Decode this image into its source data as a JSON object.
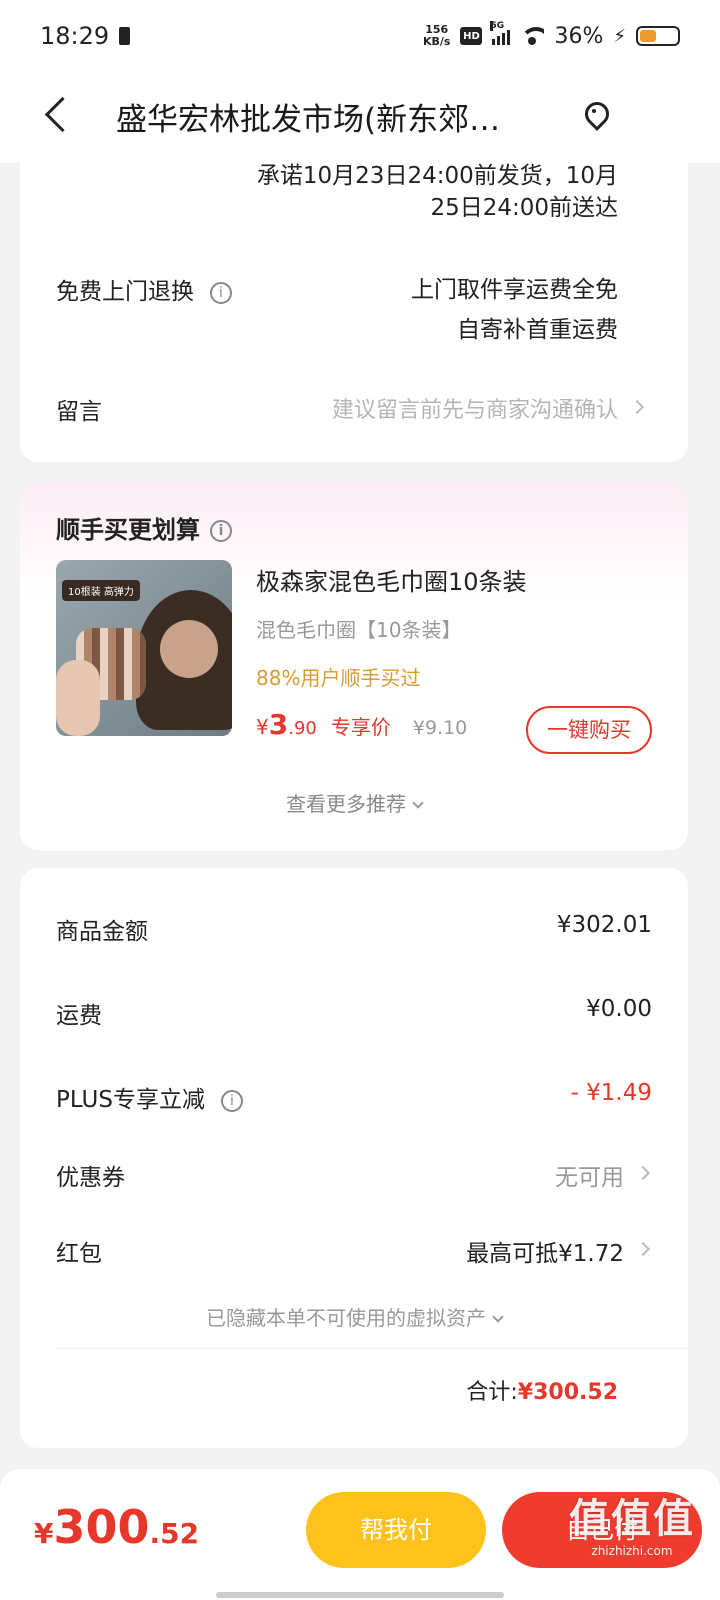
{
  "status_bar": {
    "time": "18:29",
    "net_speed_value": "156",
    "net_speed_unit": "KB/s",
    "hd": "HD",
    "network": "5G",
    "battery": "36%"
  },
  "nav": {
    "title": "盛华宏林批发市场(新东郊…"
  },
  "shipping": {
    "promise_line1": "承诺10月23日24:00前发货，10月",
    "promise_line2": "25日24:00前送达",
    "return_label": "免费上门退换",
    "return_line1": "上门取件享运费全免",
    "return_line2": "自寄补首重运费",
    "message_label": "留言",
    "message_placeholder": "建议留言前先与商家沟通确认"
  },
  "recommend": {
    "title": "顺手买更划算",
    "image_tag": "10根装 高弹力",
    "product_name": "极森家混色毛巾圈10条装",
    "sku": "混色毛巾圈【10条装】",
    "stat": "88%用户顺手买过",
    "price_symbol": "¥",
    "price_int": "3",
    "price_dec": ".90",
    "price_tag": "专享价",
    "original_price": "¥9.10",
    "buy_button": "一键购买",
    "more": "查看更多推荐"
  },
  "summary": {
    "goods_label": "商品金额",
    "goods_value": "¥302.01",
    "shipping_label": "运费",
    "shipping_value": "¥0.00",
    "plus_label": "PLUS专享立减",
    "plus_value": "- ¥1.49",
    "coupon_label": "优惠券",
    "coupon_value": "无可用",
    "redpacket_label": "红包",
    "redpacket_value": "最高可抵¥1.72",
    "hidden_assets": "已隐藏本单不可使用的虚拟资产",
    "total_label": "合计:",
    "total_value": "¥300.52"
  },
  "bottom": {
    "price_symbol": "¥",
    "price_int": "300",
    "price_dec": ".52",
    "help_pay": "帮我付",
    "self_pay": "自己付",
    "watermark_big": "值值值",
    "watermark_small": "zhizhizhi.com"
  },
  "colors": {
    "accent_red": "#e6372b",
    "help_yellow": "#ffc21a",
    "stat_orange": "#d99a30"
  }
}
